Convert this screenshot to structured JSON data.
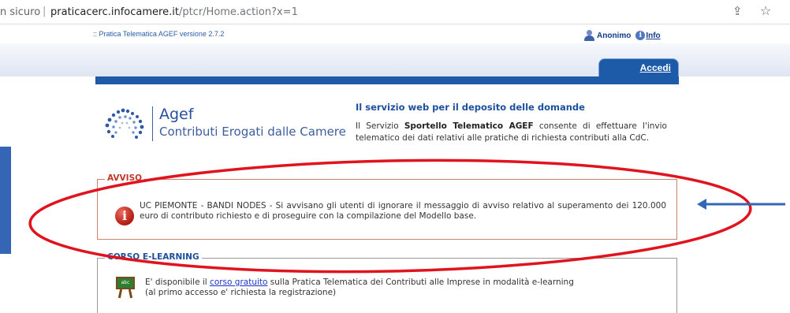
{
  "browser": {
    "secure_label": "n sicuro",
    "url_host": "praticacerc.infocamere.it",
    "url_path": "/ptcr/Home.action?x=1",
    "icons": [
      "share-icon",
      "star-icon"
    ]
  },
  "header": {
    "version": ":: Pratica Telematica AGEF versione 2.7.2",
    "user": "Anonimo",
    "info": "Info",
    "login": "Accedi"
  },
  "logo": {
    "title": "Agef",
    "subtitle": "Contributi Erogati dalle Camere"
  },
  "intro": {
    "title": "Il servizio web per il deposito delle domande",
    "text_before": "Il Servizio ",
    "text_bold": "Sportello Telematico AGEF",
    "text_after": " consente di effettuare l'invio telematico dei dati relativi alle pratiche di richiesta contributi alla CdC."
  },
  "avviso": {
    "legend": "AVVISO",
    "message": "UC PIEMONTE - BANDI NODES - Si avvisano gli utenti di ignorare il messaggio di avviso relativo al superamento dei 120.000 euro di contributo richiesto e di proseguire con la compilazione del Modello base."
  },
  "corso": {
    "legend": "CORSO E-LEARNING",
    "text_before": "E' disponibile il ",
    "link": "corso gratuito",
    "text_after": " sulla Pratica Telematica dei Contributi alle Imprese in modalità e-learning",
    "line2": "(al primo accesso e' richiesta la registrazione)",
    "board_text": "abc"
  },
  "colors": {
    "brand_blue": "#1d5aa7",
    "annotation_red": "#e0141e",
    "annotation_arrow": "#3566b5"
  }
}
